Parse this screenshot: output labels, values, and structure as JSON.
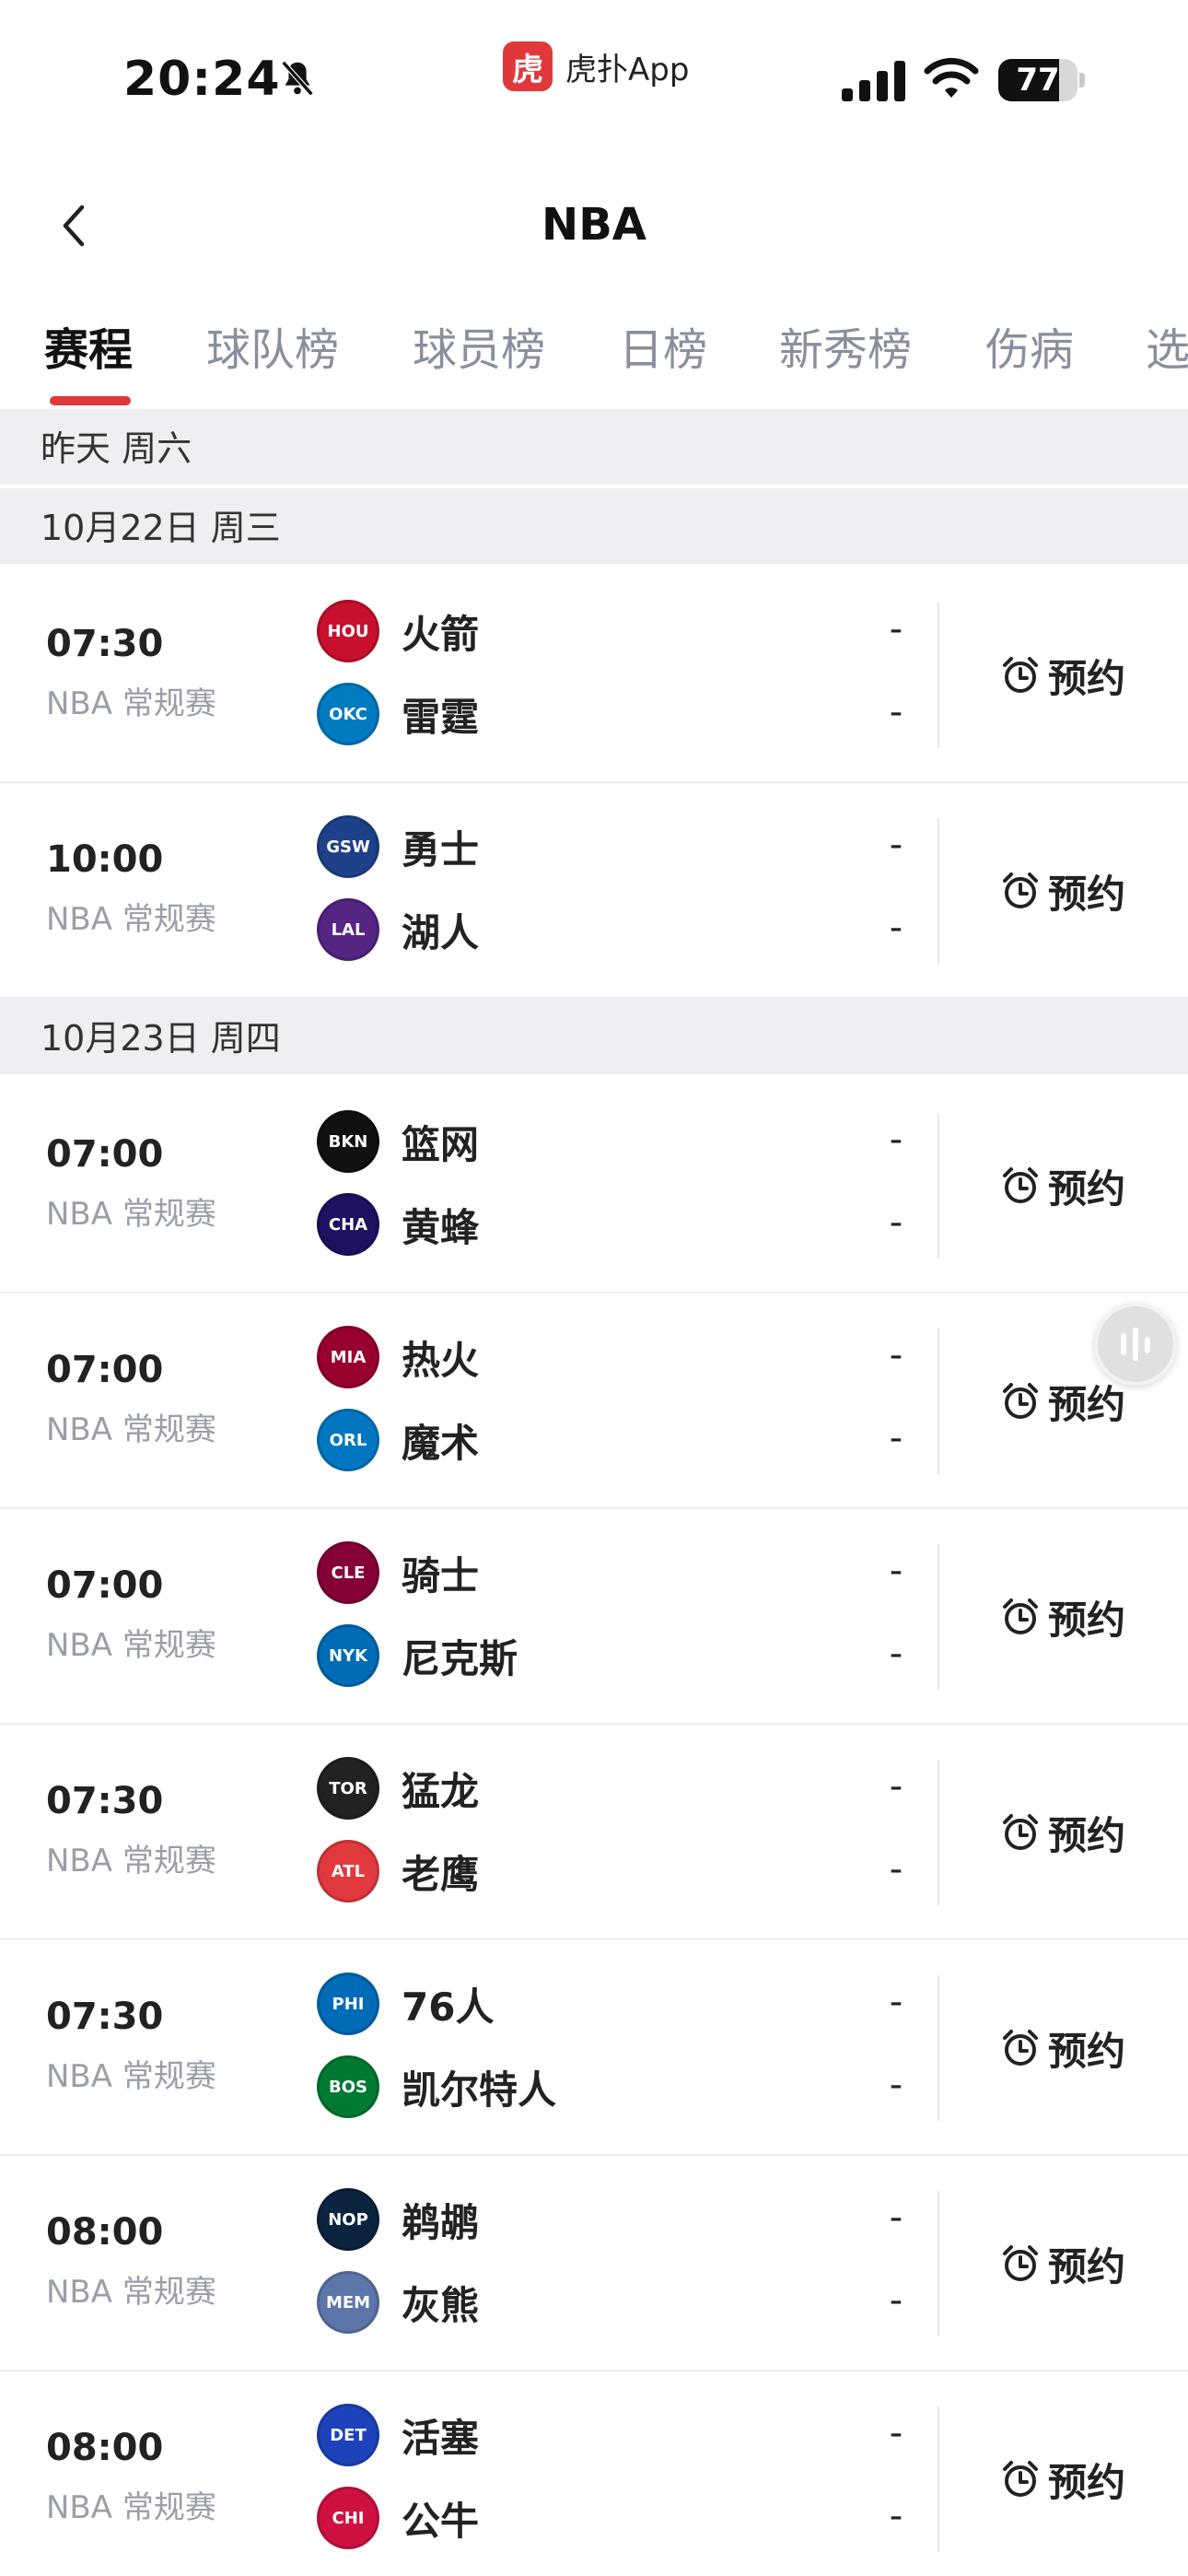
{
  "status_bar": {
    "time": "20:24",
    "app_logo_text": "虎",
    "app_name": "虎扑App",
    "battery": "77",
    "battery_fraction": 0.77
  },
  "nav": {
    "title": "NBA"
  },
  "tabs": [
    {
      "label": "赛程",
      "active": true
    },
    {
      "label": "球队榜"
    },
    {
      "label": "球员榜"
    },
    {
      "label": "日榜"
    },
    {
      "label": "新秀榜"
    },
    {
      "label": "伤病"
    },
    {
      "label": "选"
    }
  ],
  "sections": [
    {
      "date": "昨天 周六",
      "games": []
    },
    {
      "date": "10月22日 周三",
      "games": [
        {
          "time": "07:30",
          "type": "NBA 常规赛",
          "home": {
            "name": "火箭",
            "abbr": "HOU",
            "color": "#c8102e"
          },
          "away": {
            "name": "雷霆",
            "abbr": "OKC",
            "color": "#007ac1"
          },
          "score1": "-",
          "score2": "-",
          "action": "预约"
        },
        {
          "time": "10:00",
          "type": "NBA 常规赛",
          "home": {
            "name": "勇士",
            "abbr": "GSW",
            "color": "#1d428a"
          },
          "away": {
            "name": "湖人",
            "abbr": "LAL",
            "color": "#552583"
          },
          "score1": "-",
          "score2": "-",
          "action": "预约"
        }
      ]
    },
    {
      "date": "10月23日 周四",
      "games": [
        {
          "time": "07:00",
          "type": "NBA 常规赛",
          "home": {
            "name": "篮网",
            "abbr": "BKN",
            "color": "#111111"
          },
          "away": {
            "name": "黄蜂",
            "abbr": "CHA",
            "color": "#1d1160"
          },
          "score1": "-",
          "score2": "-",
          "action": "预约"
        },
        {
          "time": "07:00",
          "type": "NBA 常规赛",
          "home": {
            "name": "热火",
            "abbr": "MIA",
            "color": "#98002e"
          },
          "away": {
            "name": "魔术",
            "abbr": "ORL",
            "color": "#0077c0"
          },
          "score1": "-",
          "score2": "-",
          "action": "预约"
        },
        {
          "time": "07:00",
          "type": "NBA 常规赛",
          "home": {
            "name": "骑士",
            "abbr": "CLE",
            "color": "#860038"
          },
          "away": {
            "name": "尼克斯",
            "abbr": "NYK",
            "color": "#006bb6"
          },
          "score1": "-",
          "score2": "-",
          "action": "预约"
        },
        {
          "time": "07:30",
          "type": "NBA 常规赛",
          "home": {
            "name": "猛龙",
            "abbr": "TOR",
            "color": "#222222"
          },
          "away": {
            "name": "老鹰",
            "abbr": "ATL",
            "color": "#e03a3e"
          },
          "score1": "-",
          "score2": "-",
          "action": "预约"
        },
        {
          "time": "07:30",
          "type": "NBA 常规赛",
          "home": {
            "name": "76人",
            "abbr": "PHI",
            "color": "#006bb6"
          },
          "away": {
            "name": "凯尔特人",
            "abbr": "BOS",
            "color": "#007a33"
          },
          "score1": "-",
          "score2": "-",
          "action": "预约"
        },
        {
          "time": "08:00",
          "type": "NBA 常规赛",
          "home": {
            "name": "鹈鹕",
            "abbr": "NOP",
            "color": "#0c2340"
          },
          "away": {
            "name": "灰熊",
            "abbr": "MEM",
            "color": "#5d76a9"
          },
          "score1": "-",
          "score2": "-",
          "action": "预约"
        },
        {
          "time": "08:00",
          "type": "NBA 常规赛",
          "home": {
            "name": "活塞",
            "abbr": "DET",
            "color": "#1d42ba"
          },
          "away": {
            "name": "公牛",
            "abbr": "CHI",
            "color": "#ce1141"
          },
          "score1": "-",
          "score2": "-",
          "action": "预约"
        }
      ]
    }
  ],
  "colors": {
    "accent": "#e2383c",
    "section_bg": "#eeeff2",
    "muted": "#9a9ea8"
  }
}
